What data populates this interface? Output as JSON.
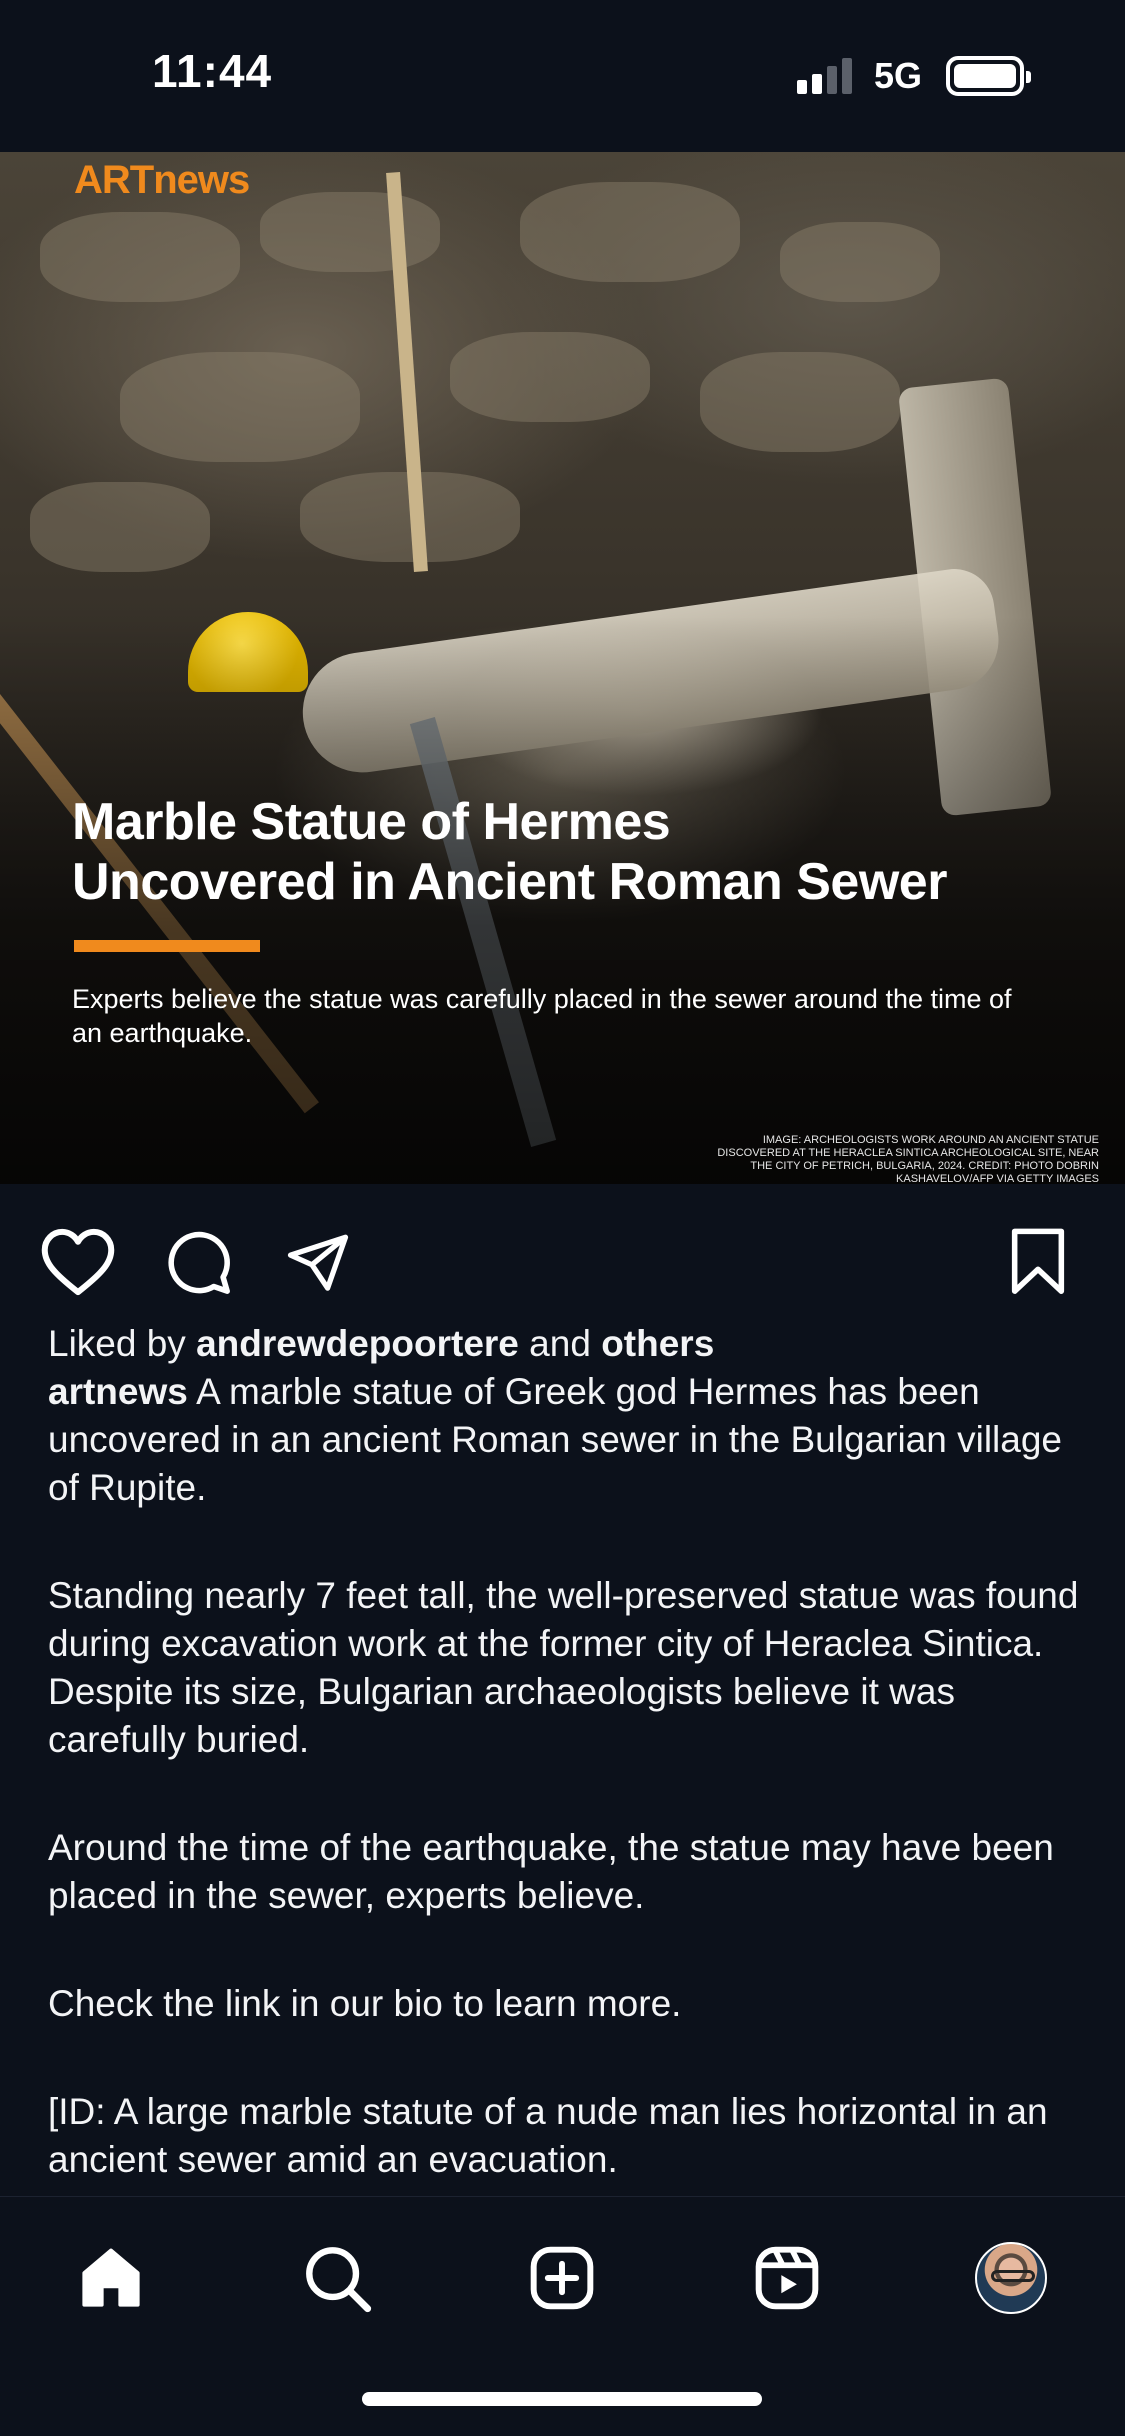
{
  "status_bar": {
    "time": "11:44",
    "network": "5G"
  },
  "post": {
    "image": {
      "brand_logo": "ARTnews",
      "headline_line1": "Marble Statue of Hermes",
      "headline_line2": "Uncovered in Ancient Roman Sewer",
      "subheadline": "Experts believe the statue was carefully placed in the sewer around the time of an earthquake.",
      "credit_line1": "IMAGE: ARCHEOLOGISTS WORK AROUND AN ANCIENT STATUE",
      "credit_line2": "DISCOVERED AT THE HERACLEA SINTICA ARCHEOLOGICAL SITE, NEAR",
      "credit_line3": "THE CITY OF PETRICH, BULGARIA, 2024. CREDIT: PHOTO DOBRIN",
      "credit_line4": "KASHAVELOV/AFP VIA GETTY IMAGES"
    },
    "actions": {
      "like_icon": "heart-icon",
      "comment_icon": "comment-icon",
      "share_icon": "send-icon",
      "save_icon": "bookmark-icon"
    },
    "likes": {
      "prefix": "Liked by ",
      "user": "andrewdepoortere",
      "middle": " and ",
      "others": "others"
    },
    "caption": {
      "author": "artnews",
      "para1": " A marble statue of Greek god Hermes has been uncovered in an ancient Roman sewer in the Bulgarian village of Rupite.",
      "para2": "Standing nearly 7 feet tall, the well-preserved statue was found during excavation work at the former city of Heraclea Sintica. Despite its size, Bulgarian archaeologists believe it was carefully buried.",
      "para3": "Around the time of the earthquake, the statue may have been placed in the sewer, experts believe.",
      "para4": "Check the link in our bio to learn more.",
      "para5": "[ID: A large marble statute of a nude man lies horizontal in an ancient sewer amid an evacuation."
    }
  },
  "bottom_nav": {
    "items": [
      {
        "name": "home",
        "icon": "home-icon",
        "active": true
      },
      {
        "name": "search",
        "icon": "search-icon"
      },
      {
        "name": "create",
        "icon": "plus-square-icon"
      },
      {
        "name": "reels",
        "icon": "reels-icon"
      },
      {
        "name": "profile",
        "icon": "avatar"
      }
    ]
  },
  "colors": {
    "background": "#0c111b",
    "brand_accent": "#f08a1d",
    "text": "#f3f4f6"
  }
}
